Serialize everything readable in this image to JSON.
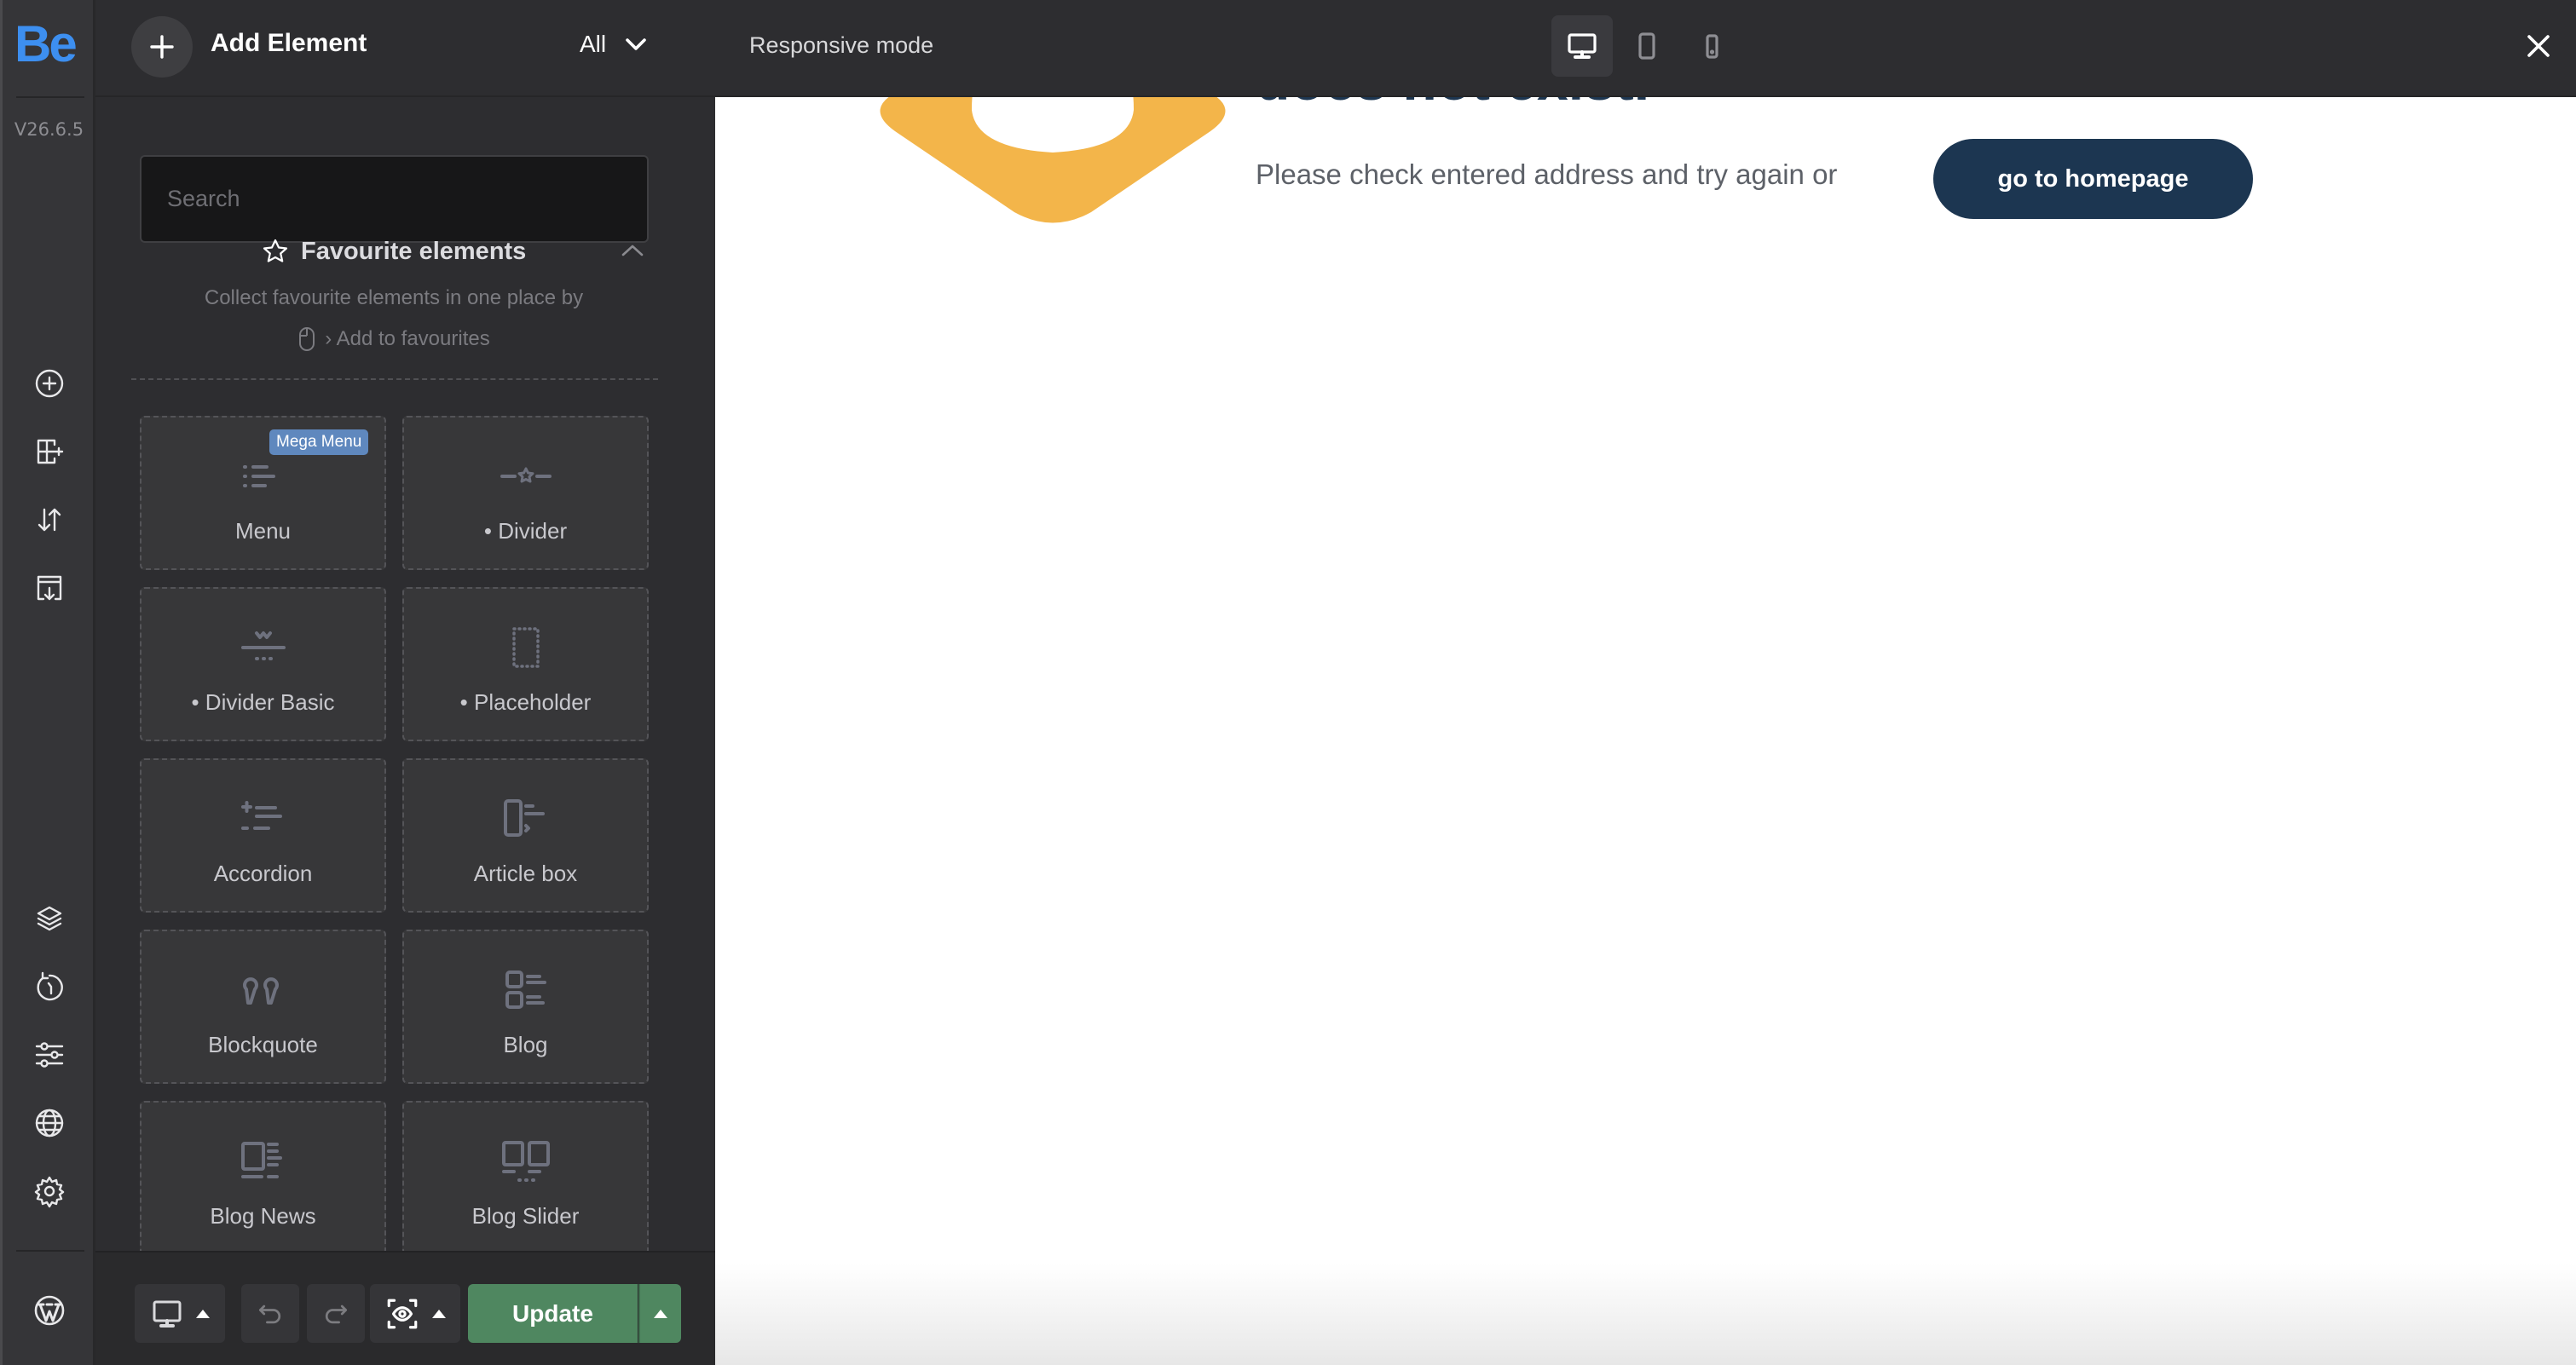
{
  "rail": {
    "logo": "Be",
    "version": "V26.6.5",
    "top_items": [
      {
        "name": "add-element",
        "icon": "plus-circle-icon"
      },
      {
        "name": "add-section",
        "icon": "layout-add-icon"
      },
      {
        "name": "sort",
        "icon": "sort-arrows-icon"
      },
      {
        "name": "templates",
        "icon": "template-import-icon"
      }
    ],
    "bottom_items": [
      {
        "name": "navigator",
        "icon": "layers-icon"
      },
      {
        "name": "history",
        "icon": "history-icon"
      },
      {
        "name": "options",
        "icon": "sliders-icon"
      },
      {
        "name": "global",
        "icon": "globe-icon"
      },
      {
        "name": "settings",
        "icon": "gear-icon"
      }
    ],
    "wordpress_icon": "wordpress-icon"
  },
  "topbar": {
    "add_title": "Add Element",
    "filter_value": "All",
    "responsive_label": "Responsive mode",
    "devices": [
      {
        "name": "desktop",
        "active": true
      },
      {
        "name": "tablet",
        "active": false
      },
      {
        "name": "mobile",
        "active": false
      }
    ]
  },
  "panel": {
    "search_placeholder": "Search",
    "search_value": "",
    "favourites": {
      "title": "Favourite elements",
      "desc_line1": "Collect favourite elements in one place by",
      "desc_line2": "› Add to favourites"
    },
    "elements": [
      {
        "label": "Menu",
        "icon": "menu-list-icon",
        "badge": "Mega Menu"
      },
      {
        "label": "• Divider",
        "icon": "divider-star-icon"
      },
      {
        "label": "• Divider Basic",
        "icon": "divider-basic-icon"
      },
      {
        "label": "• Placeholder",
        "icon": "placeholder-icon"
      },
      {
        "label": "Accordion",
        "icon": "accordion-icon"
      },
      {
        "label": "Article box",
        "icon": "article-box-icon"
      },
      {
        "label": "Blockquote",
        "icon": "blockquote-icon"
      },
      {
        "label": "Blog",
        "icon": "blog-icon"
      },
      {
        "label": "Blog News",
        "icon": "blog-news-icon"
      },
      {
        "label": "Blog Slider",
        "icon": "blog-slider-icon"
      }
    ],
    "bottom": {
      "update_label": "Update"
    }
  },
  "canvas": {
    "heading": "does not exist.",
    "message": "Please check entered address and try again or",
    "button_label": "go to homepage",
    "colors": {
      "accent": "#f3b54a",
      "navy": "#1c3651"
    }
  }
}
